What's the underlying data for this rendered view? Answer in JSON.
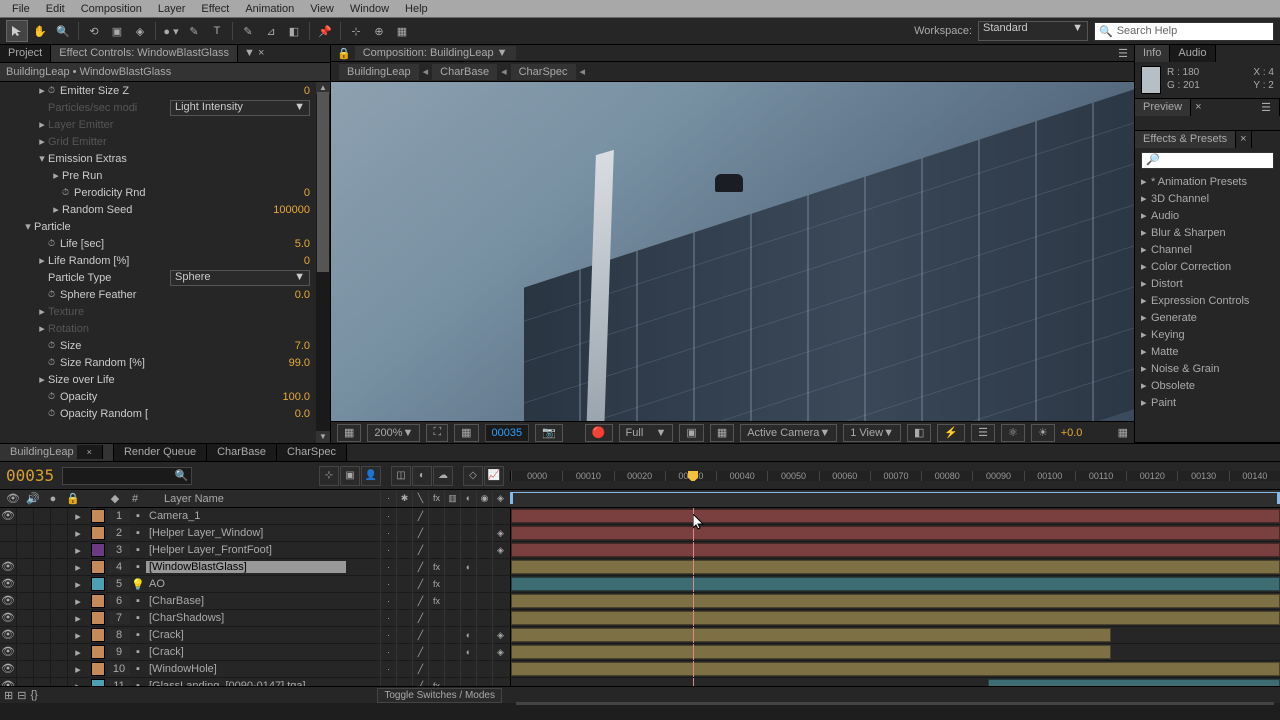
{
  "menu": [
    "File",
    "Edit",
    "Composition",
    "Layer",
    "Effect",
    "Animation",
    "View",
    "Window",
    "Help"
  ],
  "workspace": {
    "label": "Workspace:",
    "value": "Standard"
  },
  "search": {
    "value": "Search Help"
  },
  "left_panel": {
    "tabs": [
      "Project",
      "Effect Controls: WindowBlastGlass"
    ],
    "breadcrumb": "BuildingLeap • WindowBlastGlass",
    "rows": [
      {
        "indent": 2,
        "tw": "▸",
        "stopwatch": true,
        "label": "Emitter Size Z",
        "value": "0"
      },
      {
        "indent": 2,
        "tw": "",
        "label": "Particles/sec modi",
        "select": "Light Intensity",
        "dim": true
      },
      {
        "indent": 2,
        "tw": "▸",
        "label": "Layer Emitter",
        "dim": true
      },
      {
        "indent": 2,
        "tw": "▸",
        "label": "Grid Emitter",
        "dim": true
      },
      {
        "indent": 2,
        "tw": "▾",
        "label": "Emission Extras"
      },
      {
        "indent": 3,
        "tw": "▸",
        "label": "Pre Run"
      },
      {
        "indent": 3,
        "tw": "",
        "stopwatch": true,
        "label": "Perodicity Rnd",
        "value": "0"
      },
      {
        "indent": 3,
        "tw": "▸",
        "label": "Random Seed",
        "value": "100000"
      },
      {
        "indent": 1,
        "tw": "▾",
        "label": "Particle"
      },
      {
        "indent": 2,
        "tw": "",
        "stopwatch": true,
        "label": "Life [sec]",
        "value": "5.0"
      },
      {
        "indent": 2,
        "tw": "▸",
        "label": "Life Random [%]",
        "value": "0"
      },
      {
        "indent": 2,
        "tw": "",
        "label": "Particle Type",
        "select": "Sphere"
      },
      {
        "indent": 2,
        "tw": "",
        "stopwatch": true,
        "label": "Sphere Feather",
        "value": "0.0"
      },
      {
        "indent": 2,
        "tw": "▸",
        "label": "Texture",
        "dim": true
      },
      {
        "indent": 2,
        "tw": "▸",
        "label": "Rotation",
        "dim": true
      },
      {
        "indent": 2,
        "tw": "",
        "stopwatch": true,
        "label": "Size",
        "value": "7.0"
      },
      {
        "indent": 2,
        "tw": "",
        "stopwatch": true,
        "label": "Size Random [%]",
        "value": "99.0"
      },
      {
        "indent": 2,
        "tw": "▸",
        "label": "Size over Life"
      },
      {
        "indent": 2,
        "tw": "",
        "stopwatch": true,
        "label": "Opacity",
        "value": "100.0"
      },
      {
        "indent": 2,
        "tw": "",
        "stopwatch": true,
        "label": "Opacity Random [",
        "value": "0.0"
      }
    ]
  },
  "comp": {
    "dropdown_label": "Composition: BuildingLeap",
    "chain": [
      "BuildingLeap",
      "CharBase",
      "CharSpec"
    ]
  },
  "viewer_strip": {
    "zoom": "200%",
    "time": "00035",
    "resolution": "Full",
    "camera": "Active Camera",
    "view": "1 View",
    "exposure": "+0.0"
  },
  "info": {
    "tabs": [
      "Info",
      "Audio"
    ],
    "R": "R : 180",
    "G": "G : 201",
    "B": "+",
    "X": "X : 4",
    "Y": "Y : 2"
  },
  "preview_tab": "Preview",
  "effects_presets": {
    "title": "Effects & Presets",
    "items": [
      "* Animation Presets",
      "3D Channel",
      "Audio",
      "Blur & Sharpen",
      "Channel",
      "Color Correction",
      "Distort",
      "Expression Controls",
      "Generate",
      "Keying",
      "Matte",
      "Noise & Grain",
      "Obsolete",
      "Paint"
    ]
  },
  "timeline": {
    "tabs": [
      "BuildingLeap",
      "Render Queue",
      "CharBase",
      "CharSpec"
    ],
    "time": "00035",
    "ruler": [
      "0000",
      "00010",
      "00020",
      "00030",
      "00040",
      "00050",
      "00060",
      "00070",
      "00080",
      "00090",
      "00100",
      "00110",
      "00120",
      "00130",
      "00140"
    ],
    "header_label": "Layer Name",
    "header_num": "#",
    "layers": [
      {
        "num": 1,
        "color": "#c58a57",
        "name": "Camera_1",
        "eye": true,
        "bar_color": "#7a4040",
        "bar_l": 0,
        "bar_r": 100,
        "switches": [
          ".▪."
        ]
      },
      {
        "num": 2,
        "color": "#c58a57",
        "name": "[Helper Layer_Window]",
        "eye": false,
        "bar_color": "#7a4040",
        "bar_l": 0,
        "bar_r": 100,
        "switches": [
          ".▪.",
          "",
          "/"
        ],
        "cube": true
      },
      {
        "num": 3,
        "color": "#6b3a82",
        "name": "[Helper Layer_FrontFoot]",
        "eye": false,
        "bar_color": "#7a4040",
        "bar_l": 0,
        "bar_r": 100,
        "switches": [
          ".▪.",
          "",
          "/"
        ],
        "cube": true
      },
      {
        "num": 4,
        "color": "#c58a57",
        "name": "[WindowBlastGlass]",
        "eye": true,
        "selected": true,
        "bar_color": "#7d7045",
        "bar_l": 0,
        "bar_r": 100,
        "switches": [
          ".▪.",
          "",
          "/",
          "fx"
        ],
        "mb": true
      },
      {
        "num": 5,
        "color": "#4aa0b5",
        "name": "AO",
        "eye": true,
        "bar_color": "#3d6d73",
        "bar_l": 0,
        "bar_r": 100,
        "switches": [
          ".▪.",
          "",
          "/",
          "fx"
        ],
        "bulb": true
      },
      {
        "num": 6,
        "color": "#c58a57",
        "name": "[CharBase]",
        "eye": true,
        "bar_color": "#7d7045",
        "bar_l": 0,
        "bar_r": 100,
        "switches": [
          ".▪.",
          "",
          "/",
          "fx"
        ]
      },
      {
        "num": 7,
        "color": "#c58a57",
        "name": "[CharShadows]",
        "eye": true,
        "bar_color": "#7d7045",
        "bar_l": 0,
        "bar_r": 100,
        "switches": [
          ".▪.",
          "",
          "/"
        ]
      },
      {
        "num": 8,
        "color": "#c58a57",
        "name": "[Crack]",
        "eye": true,
        "bar_color": "#7d7045",
        "bar_l": 0,
        "bar_r": 78,
        "switches": [
          ".▪.",
          "",
          "/"
        ],
        "mb": true,
        "cube": true
      },
      {
        "num": 9,
        "color": "#c58a57",
        "name": "[Crack]",
        "eye": true,
        "bar_color": "#7d7045",
        "bar_l": 0,
        "bar_r": 78,
        "switches": [
          ".▪.",
          "",
          "/"
        ],
        "mb": true,
        "cube": true
      },
      {
        "num": 10,
        "color": "#c58a57",
        "name": "[WindowHole]",
        "eye": true,
        "bar_color": "#7d7045",
        "bar_l": 0,
        "bar_r": 100,
        "switches": [
          ".▪.",
          "",
          "/"
        ]
      },
      {
        "num": 11,
        "color": "#4aa0b5",
        "name": "[GlassLanding_[0090-0147].tga]",
        "eye": true,
        "bar_color": "#3d6d73",
        "bar_l": 62,
        "bar_r": 100,
        "switches": [
          ".▪.",
          "",
          "/",
          "fx"
        ]
      }
    ],
    "toggle_label": "Toggle Switches / Modes"
  }
}
